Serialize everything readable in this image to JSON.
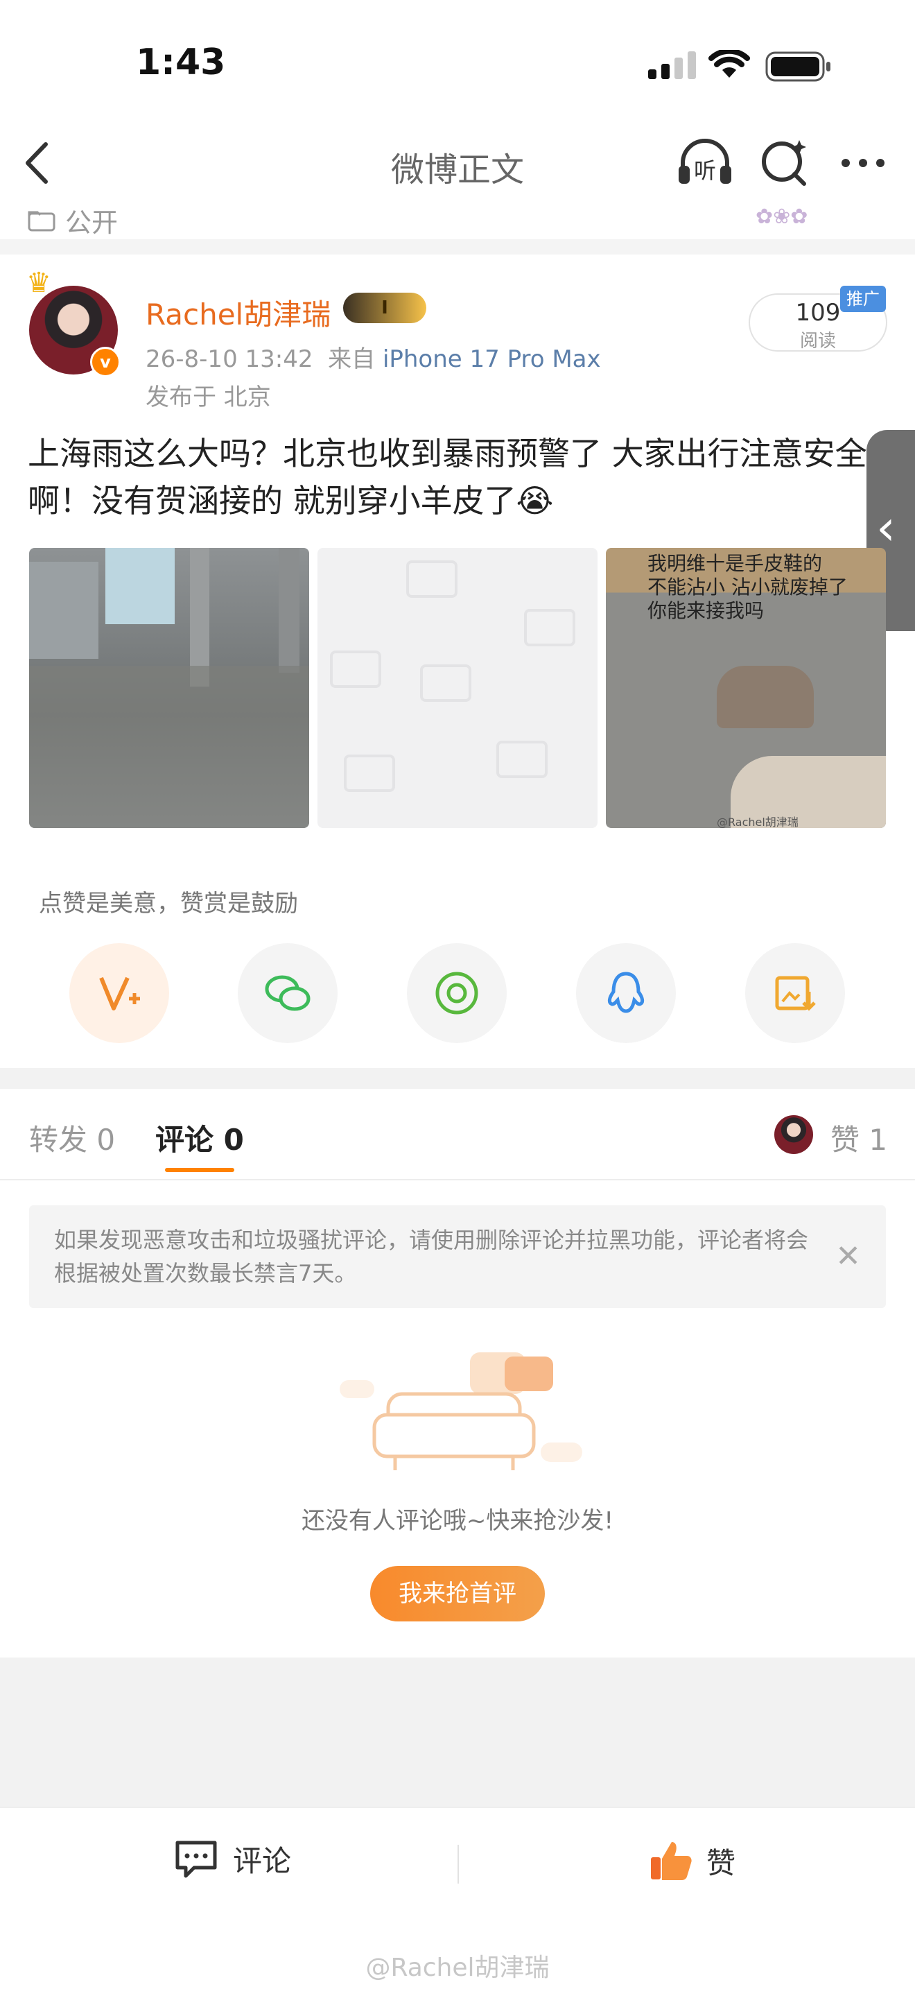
{
  "status_bar": {
    "time": "1:43"
  },
  "nav": {
    "title": "微博正文",
    "listen_label": "听"
  },
  "post": {
    "visibility": "公开",
    "author": "Rachel胡津瑞",
    "vip_label": "I",
    "timestamp": "26-8-10 13:42",
    "source_prefix": "来自",
    "source": "iPhone 17 Pro Max",
    "location": "发布于 北京",
    "read_count": "109",
    "read_label": "阅读",
    "promo_label": "推广",
    "text": "上海雨这么大吗？北京也收到暴雨预警了 大家出行注意安全啊！没有贺涵接的 就别穿小羊皮了",
    "emoji": "😭",
    "image3_note": "我明维十是手皮鞋的\n不能沾小 沾小就废掉了\n你能来接我吗",
    "image3_watermark": "@Rachel胡津瑞"
  },
  "reward": {
    "hint": "点赞是美意，赞赏是鼓励"
  },
  "share_icons": [
    "reward-v-icon",
    "wechat-icon",
    "moments-icon",
    "qq-icon",
    "save-image-icon"
  ],
  "tabs": {
    "repost_label": "转发",
    "repost_count": "0",
    "comment_label": "评论",
    "comment_count": "0",
    "like_label": "赞",
    "like_count": "1"
  },
  "notice": {
    "text": "如果发现恶意攻击和垃圾骚扰评论，请使用删除评论并拉黑功能，评论者将会根据被处置次数最长禁言7天。"
  },
  "empty_state": {
    "text": "还没有人评论哦~快来抢沙发!",
    "button": "我来抢首评"
  },
  "bottom_bar": {
    "comment_label": "评论",
    "like_label": "赞"
  },
  "watermark": "@Rachel胡津瑞",
  "colors": {
    "accent": "#ff8200",
    "author_name": "#e86b1f",
    "source_link": "#5b7ea9"
  }
}
